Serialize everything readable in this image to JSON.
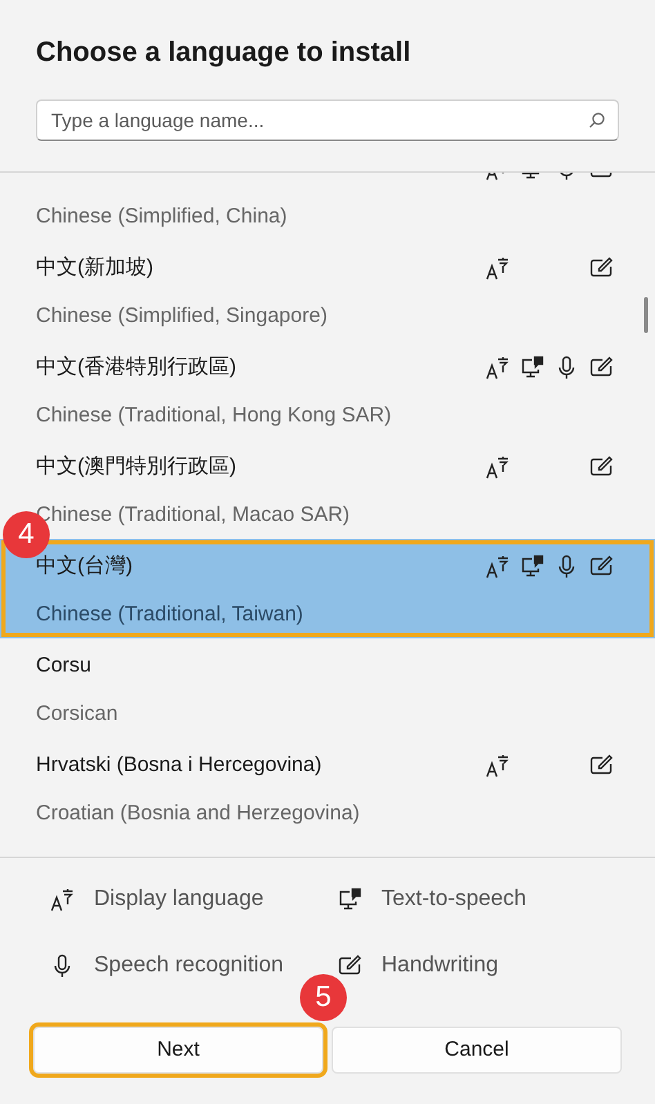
{
  "dialog": {
    "title": "Choose a language to install"
  },
  "search": {
    "placeholder": "Type a language name..."
  },
  "languages": [
    {
      "english": "Chinese (Simplified, China)",
      "display_language": true,
      "text_to_speech": true,
      "speech_recognition": true,
      "handwriting": true,
      "selected": false,
      "highlighted": false
    },
    {
      "native": "中文(新加坡)",
      "english": "Chinese (Simplified, Singapore)",
      "display_language": true,
      "text_to_speech": false,
      "speech_recognition": false,
      "handwriting": true,
      "selected": false,
      "highlighted": false
    },
    {
      "native": "中文(香港特別行政區)",
      "english": "Chinese (Traditional, Hong Kong SAR)",
      "display_language": true,
      "text_to_speech": true,
      "speech_recognition": true,
      "handwriting": true,
      "selected": false,
      "highlighted": false
    },
    {
      "native": "中文(澳門特別行政區)",
      "english": "Chinese (Traditional, Macao SAR)",
      "display_language": true,
      "text_to_speech": false,
      "speech_recognition": false,
      "handwriting": true,
      "selected": false,
      "highlighted": false
    },
    {
      "native": "中文(台灣)",
      "english": "Chinese (Traditional, Taiwan)",
      "display_language": true,
      "text_to_speech": true,
      "speech_recognition": true,
      "handwriting": true,
      "selected": true,
      "highlighted": true,
      "step_badge": "4"
    },
    {
      "native": "Corsu",
      "english": "Corsican",
      "display_language": false,
      "text_to_speech": false,
      "speech_recognition": false,
      "handwriting": false,
      "selected": false,
      "highlighted": false
    },
    {
      "native": "Hrvatski (Bosna i Hercegovina)",
      "english": "Croatian (Bosnia and Herzegovina)",
      "display_language": true,
      "text_to_speech": false,
      "speech_recognition": false,
      "handwriting": true,
      "selected": false,
      "highlighted": false
    }
  ],
  "legend": [
    {
      "kind": "display_language",
      "label": "Display language"
    },
    {
      "kind": "text_to_speech",
      "label": "Text-to-speech"
    },
    {
      "kind": "speech_recognition",
      "label": "Speech recognition"
    },
    {
      "kind": "handwriting",
      "label": "Handwriting"
    }
  ],
  "buttons": [
    {
      "label": "Next",
      "highlighted": true,
      "step_badge": "5"
    },
    {
      "label": "Cancel",
      "highlighted": false
    }
  ]
}
